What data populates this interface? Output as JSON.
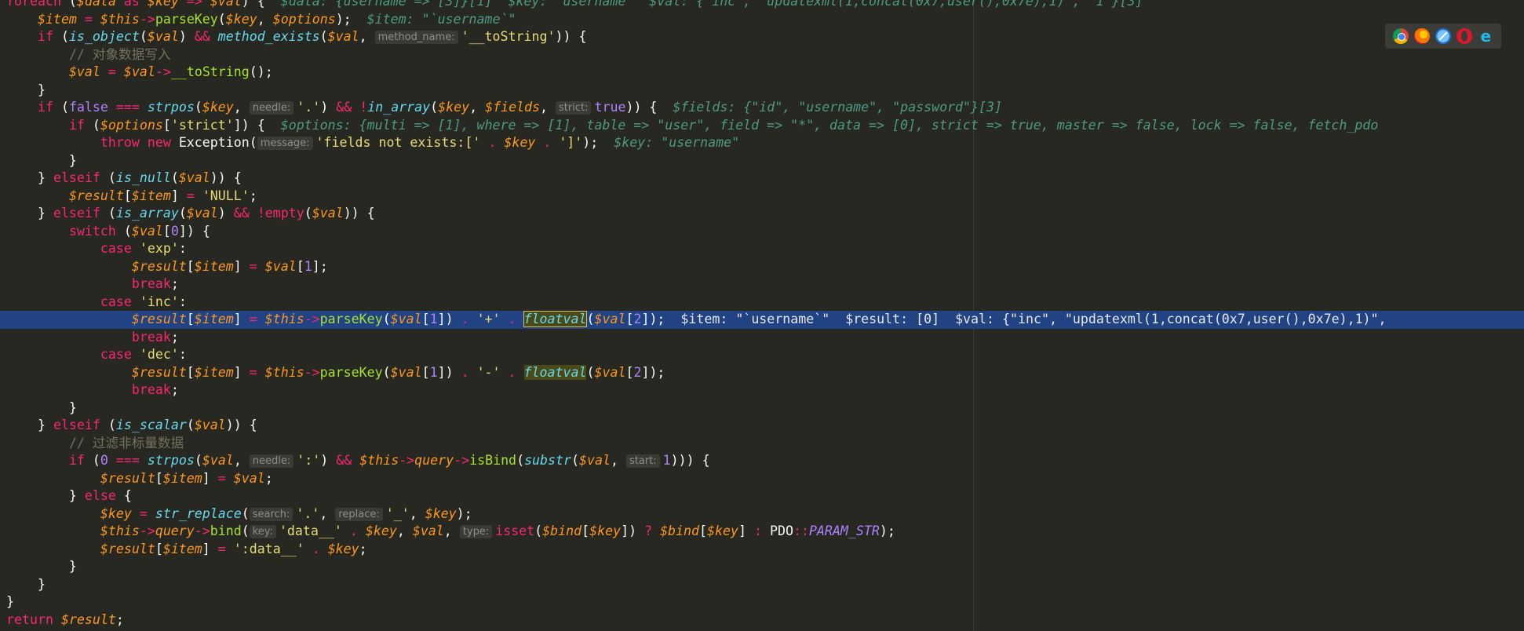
{
  "editor": {
    "top_partial": {
      "code": "foreach ($data as $key => $val) {",
      "debug": "$data: {username => [3]}[1]  $key: \"username\"  $val: {\"inc\", \"updatexml(1,concat(0x7,user(),0x7e),1)\", \"1\"}[3]"
    },
    "hints": {
      "method_name": "method_name:",
      "needle": "needle:",
      "strict": "strict:",
      "message": "message:",
      "start": "start:",
      "search": "search:",
      "replace": "replace:",
      "key": "key:",
      "type": "type:"
    },
    "comments": {
      "object_write": "// 对象数据写入",
      "filter_scalar": "// 过滤非标量数据"
    },
    "debug": {
      "item": "$item: \"`username`\"",
      "fields": "$fields: {\"id\", \"username\", \"password\"}[3]",
      "options": "$options: {multi => [1], where => [1], table => \"user\", field => \"*\", data => [0], strict => true, master => false, lock => false, fetch_pdo",
      "key": "$key: \"username\"",
      "highlighted": "$item: \"`username`\"  $result: [0]  $val: {\"inc\", \"updatexml(1,concat(0x7,user(),0x7e),1)\","
    }
  },
  "browser_bar": {
    "icons": [
      "chrome-icon",
      "firefox-icon",
      "safari-icon",
      "opera-icon",
      "ie-icon"
    ],
    "ie_glyph": "e"
  }
}
